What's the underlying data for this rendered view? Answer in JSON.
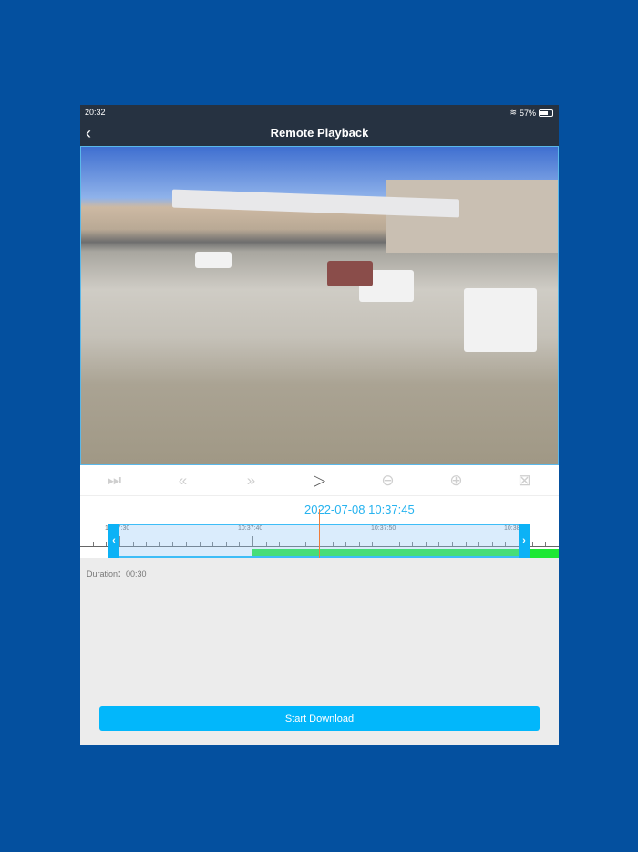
{
  "status_bar": {
    "time": "20:32",
    "battery": "57%",
    "battery_level": 0.57
  },
  "nav": {
    "title": "Remote Playback",
    "back_icon": "chevron-left-icon"
  },
  "controls": [
    {
      "name": "skip-to-end-button",
      "icon": "skip-end-icon",
      "glyph": "⏭",
      "enabled": false
    },
    {
      "name": "rewind-button",
      "icon": "rewind-icon",
      "glyph": "«",
      "enabled": false
    },
    {
      "name": "fast-forward-button",
      "icon": "fast-forward-icon",
      "glyph": "»",
      "enabled": false
    },
    {
      "name": "play-button",
      "icon": "play-icon",
      "glyph": "▷",
      "enabled": true
    },
    {
      "name": "previous-button",
      "icon": "arrow-left-circle-icon",
      "glyph": "⊖",
      "enabled": false
    },
    {
      "name": "next-button",
      "icon": "arrow-right-circle-icon",
      "glyph": "⊕",
      "enabled": false
    },
    {
      "name": "close-clip-button",
      "icon": "close-box-icon",
      "glyph": "⊠",
      "enabled": false
    }
  ],
  "timestamp": "2022-07-08 10:37:45",
  "timeline": {
    "labels": [
      "10:37:30",
      "10:37:40",
      "10:37:50",
      "10:38:00"
    ],
    "recording_start": "10:37:40"
  },
  "duration_label": "Duration：",
  "duration_value": "00:30",
  "download_button": "Start Download"
}
